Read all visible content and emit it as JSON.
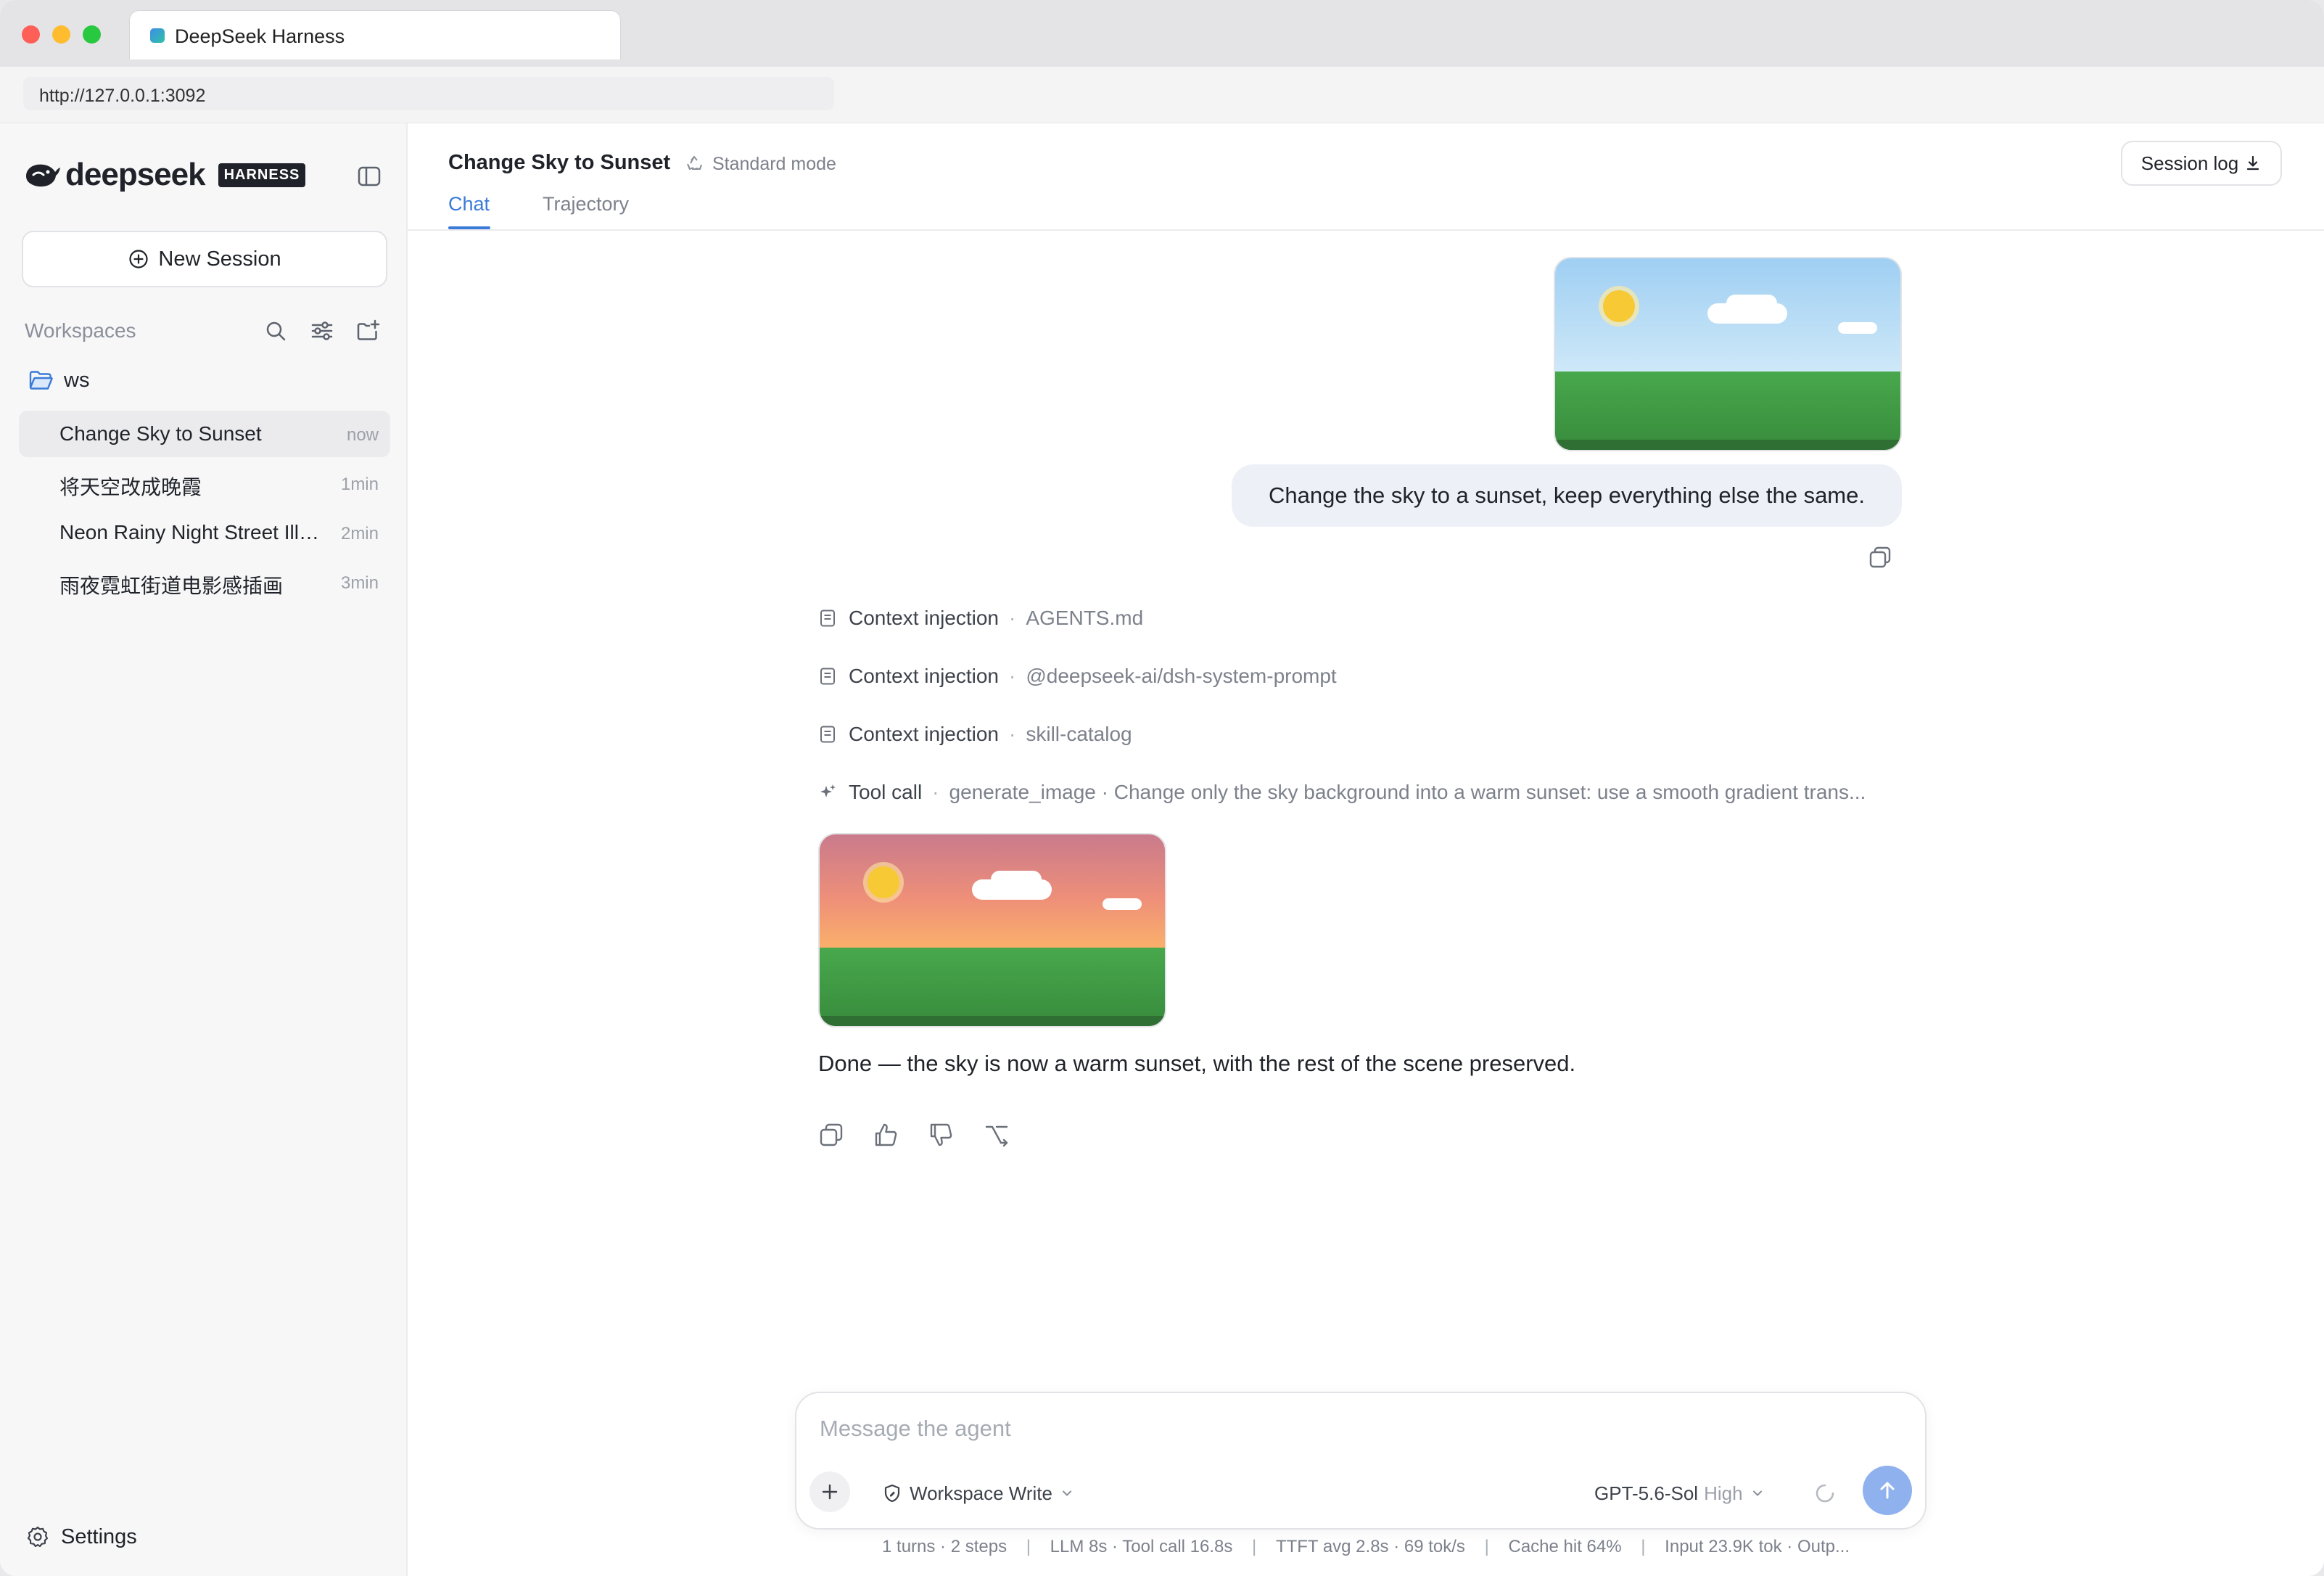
{
  "browser": {
    "tab_title": "DeepSeek Harness",
    "url": "http://127.0.0.1:3092"
  },
  "sidebar": {
    "logo_text": "deepseek",
    "logo_badge": "HARNESS",
    "new_session_label": "New Session",
    "workspaces_label": "Workspaces",
    "workspace_folder": "ws",
    "sessions": [
      {
        "title": "Change Sky to Sunset",
        "time": "now",
        "active": true
      },
      {
        "title": "将天空改成晚霞",
        "time": "1min",
        "active": false
      },
      {
        "title": "Neon Rainy Night Street Illustration",
        "time": "2min",
        "active": false
      },
      {
        "title": "雨夜霓虹街道电影感插画",
        "time": "3min",
        "active": false
      }
    ],
    "settings_label": "Settings"
  },
  "header": {
    "title": "Change Sky to Sunset",
    "mode": "Standard mode",
    "session_log_label": "Session log",
    "tabs": [
      {
        "label": "Chat",
        "active": true
      },
      {
        "label": "Trajectory",
        "active": false
      }
    ]
  },
  "conversation": {
    "user_message": "Change the sky to a sunset, keep everything else the same.",
    "steps": [
      {
        "kind": "Context injection",
        "detail": "AGENTS.md"
      },
      {
        "kind": "Context injection",
        "detail": "@deepseek-ai/dsh-system-prompt"
      },
      {
        "kind": "Context injection",
        "detail": "skill-catalog"
      }
    ],
    "tool_call": {
      "kind": "Tool call",
      "tool": "generate_image",
      "detail": "Change only the sky background into a warm sunset: use a smooth gradient trans..."
    },
    "assistant_message": "Done — the sky is now a warm sunset, with the rest of the scene preserved."
  },
  "composer": {
    "placeholder": "Message the agent",
    "permission": "Workspace Write",
    "model": "GPT-5.6-Sol",
    "effort": "High"
  },
  "stats": {
    "turns": "1 turns · 2 steps",
    "latency": "LLM 8s · Tool call 16.8s",
    "ttft": "TTFT avg 2.8s · 69 tok/s",
    "cache": "Cache hit 64%",
    "tokens": "Input 23.9K tok · Outp..."
  },
  "colors": {
    "accent": "#3b7bd8",
    "send_button": "#8fb2ef",
    "user_bubble": "#edf0f7",
    "day_sky": "#a9d6f5",
    "sunset_sky": "#f59a68",
    "grass": "#3f9a44"
  }
}
